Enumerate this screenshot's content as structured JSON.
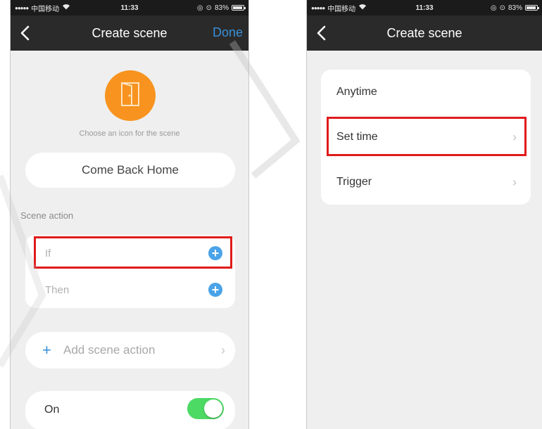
{
  "status_bar": {
    "carrier": "中国移动",
    "time": "11:33",
    "battery": "83%"
  },
  "left": {
    "nav": {
      "title": "Create scene",
      "done_label": "Done"
    },
    "icon_caption": "Choose an icon for the scene",
    "scene_name": "Come Back Home",
    "section_label": "Scene action",
    "actions": [
      {
        "label": "If"
      },
      {
        "label": "Then"
      }
    ],
    "add_action_label": "Add scene action",
    "toggle": {
      "label": "On",
      "state": "on"
    }
  },
  "right": {
    "nav": {
      "title": "Create scene"
    },
    "options": [
      {
        "label": "Anytime"
      },
      {
        "label": "Set time"
      },
      {
        "label": "Trigger"
      }
    ]
  },
  "colors": {
    "accent_blue": "#3a8fd6",
    "icon_orange": "#f7931e",
    "toggle_green": "#4cd964",
    "highlight_red": "#e01b1b",
    "nav_bar": "#2a2a2a"
  }
}
